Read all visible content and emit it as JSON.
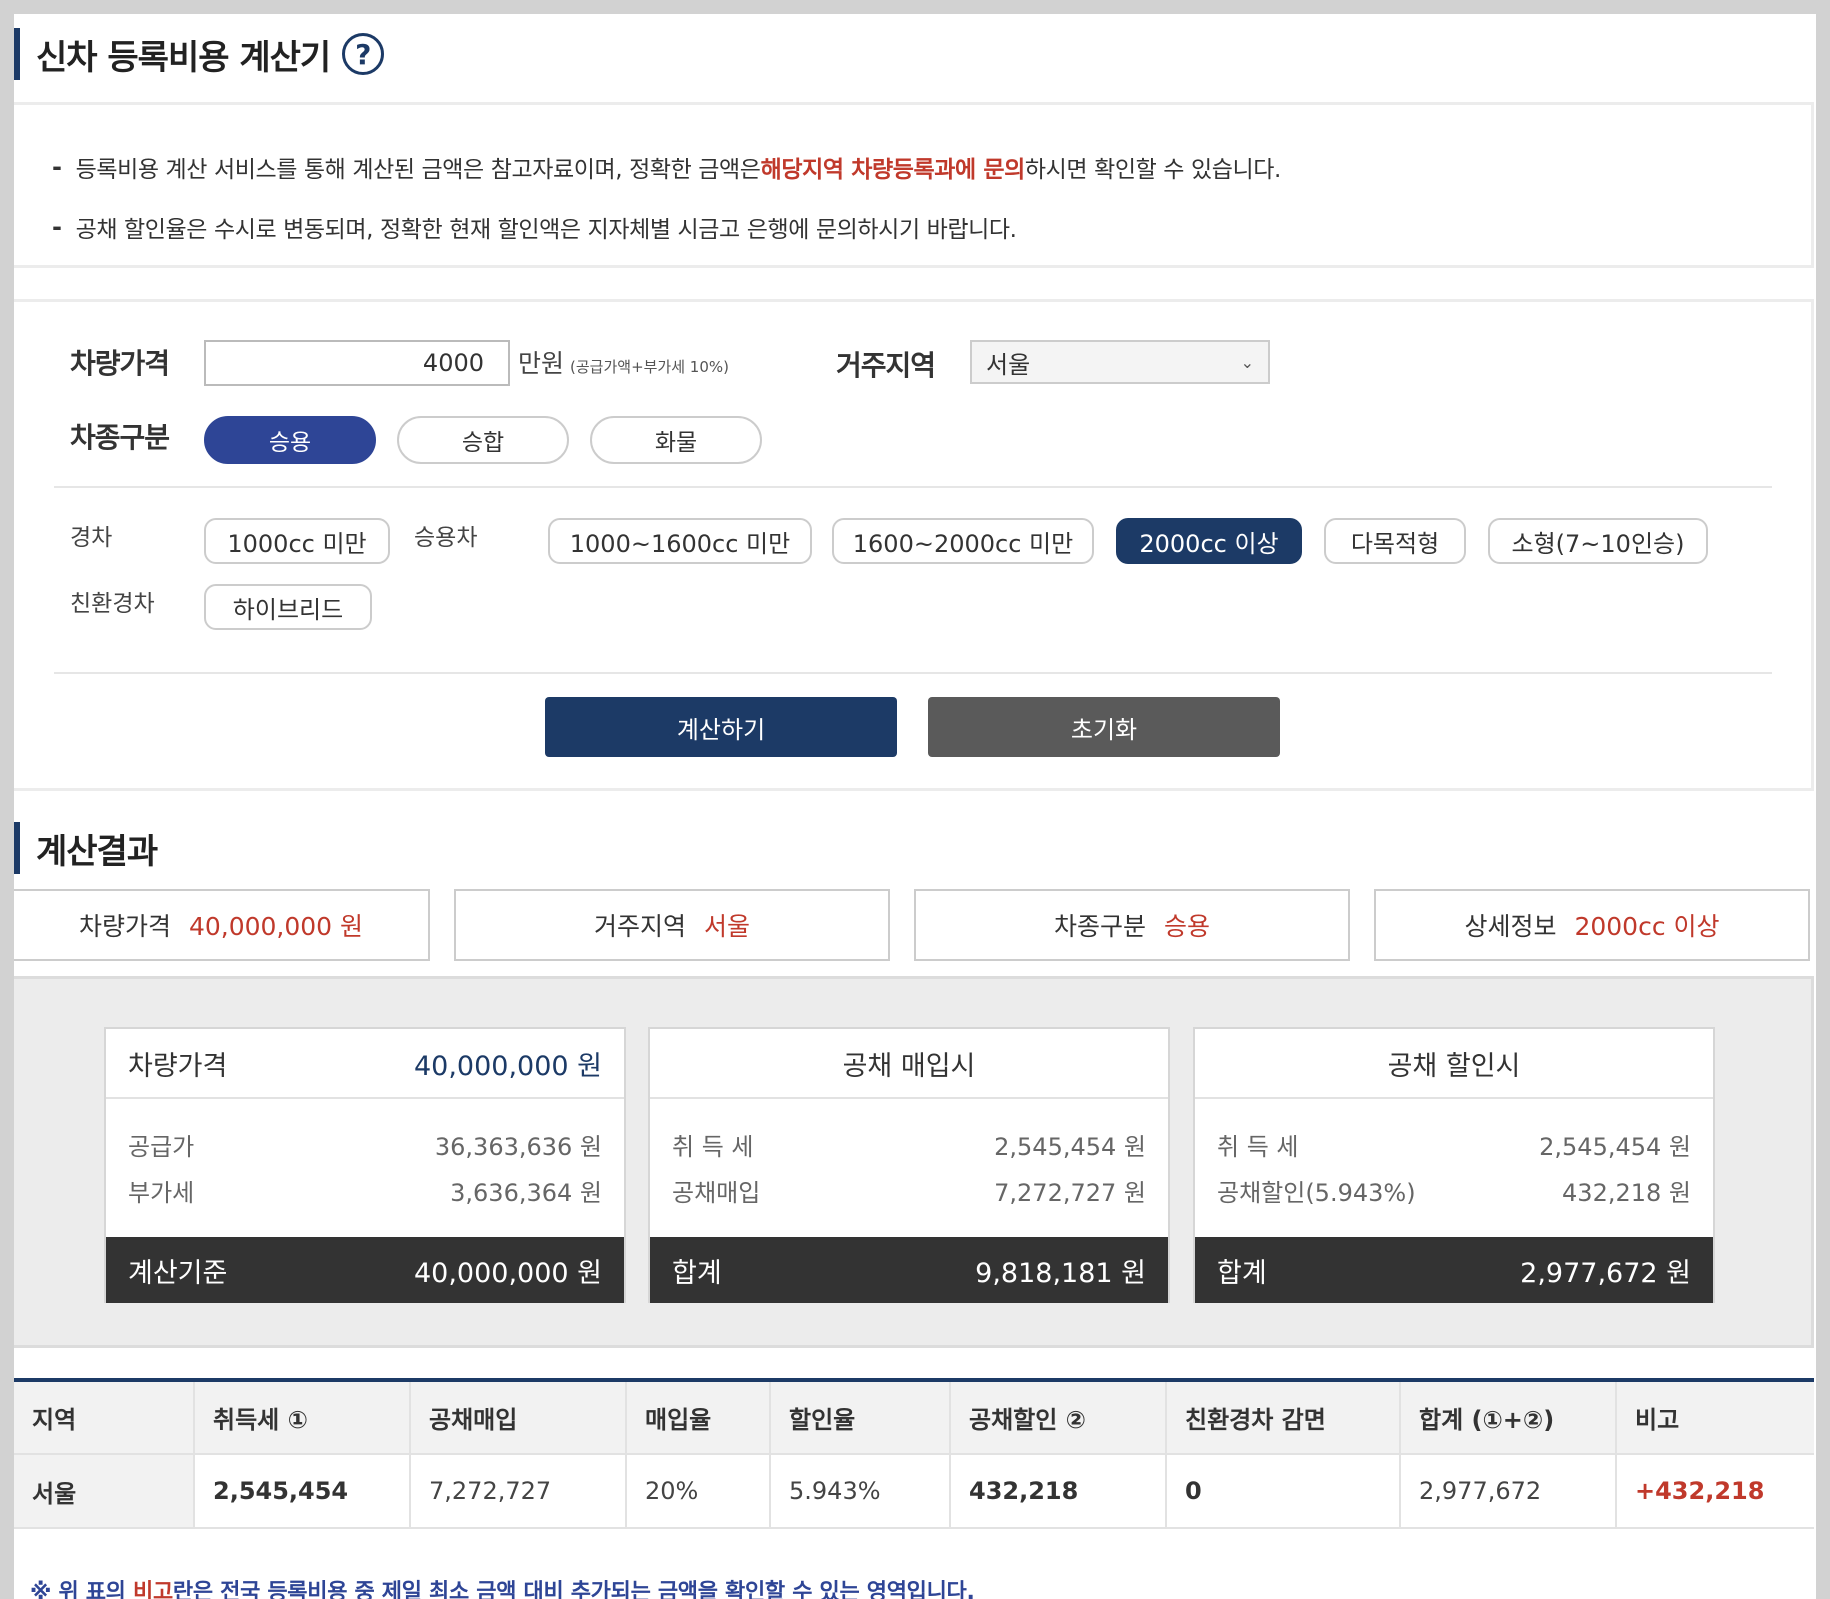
{
  "title": "신차 등록비용 계산기",
  "help_icon": "?",
  "notice": {
    "line1_pre": "등록비용 계산 서비스를 통해 계산된 금액은 참고자료이며, 정확한 금액은 ",
    "line1_hl": "해당지역 차량등록과에 문의",
    "line1_post": "하시면 확인할 수 있습니다.",
    "line2": "공채 할인율은 수시로 변동되며, 정확한 현재 할인액은 지자체별 시금고 은행에 문의하시기 바랍니다."
  },
  "form": {
    "price_label": "차량가격",
    "price_value": "4000",
    "price_unit": "만원",
    "price_note": "(공급가액+부가세 10%)",
    "region_label": "거주지역",
    "region_value": "서울",
    "type_label": "차종구분",
    "types": [
      "승용",
      "승합",
      "화물"
    ],
    "light_label": "경차",
    "light_options": [
      "1000cc 미만"
    ],
    "passenger_label": "승용차",
    "passenger_options": [
      "1000~1600cc 미만",
      "1600~2000cc 미만",
      "2000cc 이상",
      "다목적형",
      "소형(7~10인승)"
    ],
    "eco_label": "친환경차",
    "eco_options": [
      "하이브리드"
    ],
    "calc_button": "계산하기",
    "reset_button": "초기화"
  },
  "result": {
    "heading": "계산결과",
    "summary": [
      {
        "label": "차량가격",
        "value": "40,000,000 원"
      },
      {
        "label": "거주지역",
        "value": "서울"
      },
      {
        "label": "차종구분",
        "value": "승용"
      },
      {
        "label": "상세정보",
        "value": "2000cc 이상"
      }
    ],
    "cards": [
      {
        "head_label": "차량가격",
        "head_value": "40,000,000 원",
        "rows": [
          {
            "label": "공급가",
            "value": "36,363,636 원"
          },
          {
            "label": "부가세",
            "value": "3,636,364 원"
          }
        ],
        "foot_label": "계산기준",
        "foot_value": "40,000,000 원"
      },
      {
        "head_label": "공채 매입시",
        "rows": [
          {
            "label": "취 득 세",
            "value": "2,545,454 원"
          },
          {
            "label": "공채매입",
            "value": "7,272,727 원"
          }
        ],
        "foot_label": "합계",
        "foot_value": "9,818,181 원"
      },
      {
        "head_label": "공채 할인시",
        "rows": [
          {
            "label": "취 득 세",
            "value": "2,545,454 원"
          },
          {
            "label": "공채할인(5.943%)",
            "value": "432,218 원"
          }
        ],
        "foot_label": "합계",
        "foot_value": "2,977,672 원"
      }
    ]
  },
  "table": {
    "headers": [
      "지역",
      "취득세 ①",
      "공채매입",
      "매입율",
      "할인율",
      "공채할인 ②",
      "친환경차 감면",
      "합계 (①+②)",
      "비고"
    ],
    "row": [
      "서울",
      "2,545,454",
      "7,272,727",
      "20%",
      "5.943%",
      "432,218",
      "0",
      "2,977,672",
      "+432,218"
    ]
  },
  "footnote": {
    "pre": "※ 위 표의 ",
    "red": "비고",
    "post": "란은 전국 등록비용 중 제일 최소 금액 대비 추가되는 금액을 확인할 수 있는 영역입니다."
  },
  "colors": {
    "navy": "#1c3a66",
    "accent_blue": "#2e4596",
    "red": "#c0392b"
  }
}
